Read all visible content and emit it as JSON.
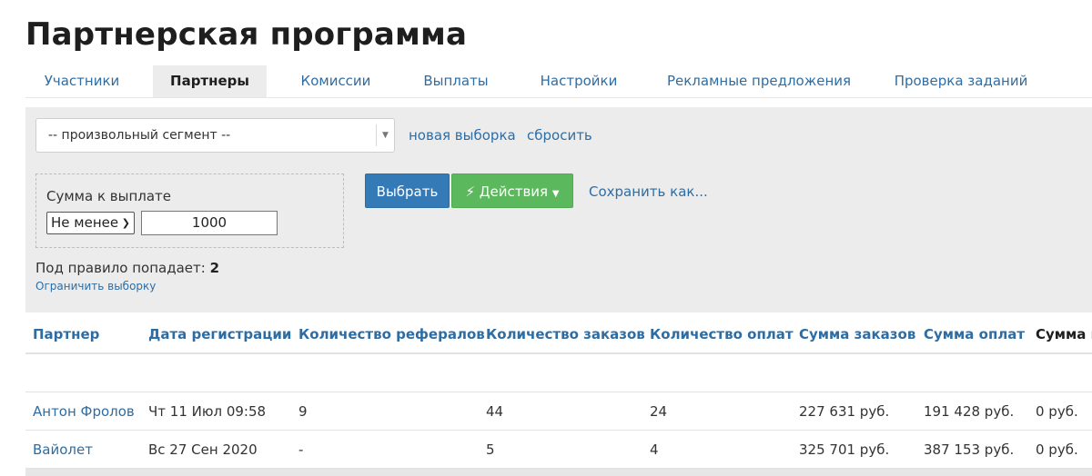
{
  "page": {
    "title": "Партнерская программа"
  },
  "tabs": [
    {
      "label": "Участники",
      "active": false
    },
    {
      "label": "Партнеры",
      "active": true
    },
    {
      "label": "Комиссии",
      "active": false
    },
    {
      "label": "Выплаты",
      "active": false
    },
    {
      "label": "Настройки",
      "active": false
    },
    {
      "label": "Рекламные предложения",
      "active": false
    },
    {
      "label": "Проверка заданий",
      "active": false
    }
  ],
  "filter": {
    "segment_value": "-- произвольный сегмент --",
    "new_selection_link": "новая выборка",
    "reset_link": "сбросить",
    "rule": {
      "label": "Сумма к выплате",
      "condition_value": "Не менее",
      "amount_value": "1000"
    },
    "select_button": "Выбрать",
    "actions_button": "Действия",
    "save_as_link": "Сохранить как...",
    "match_label": "Под правило попадает:",
    "match_count": "2",
    "limit_link": "Ограничить выборку"
  },
  "table": {
    "columns": [
      "Партнер",
      "Дата регистрации",
      "Количество рефералов",
      "Количество заказов",
      "Количество оплат",
      "Сумма заказов",
      "Сумма оплат",
      "Сумма к"
    ],
    "rows": [
      [
        "Антон Фролов",
        "Чт 11 Июл 09:58",
        "9",
        "44",
        "24",
        "227 631 руб.",
        "191 428 руб.",
        "0 руб."
      ],
      [
        "Вайолет",
        "Вс 27 Сен 2020",
        "-",
        "5",
        "4",
        "325 701 руб.",
        "387 153 руб.",
        "0 руб."
      ]
    ]
  },
  "colors": {
    "link": "#2e6da4",
    "primary_button": "#337ab7",
    "success_button": "#5cb85c",
    "panel_bg": "#ececec"
  },
  "icons": {
    "actions": "lightning-icon",
    "actions_caret": "caret-down-icon",
    "select_arrow": "triangle-down-icon"
  }
}
